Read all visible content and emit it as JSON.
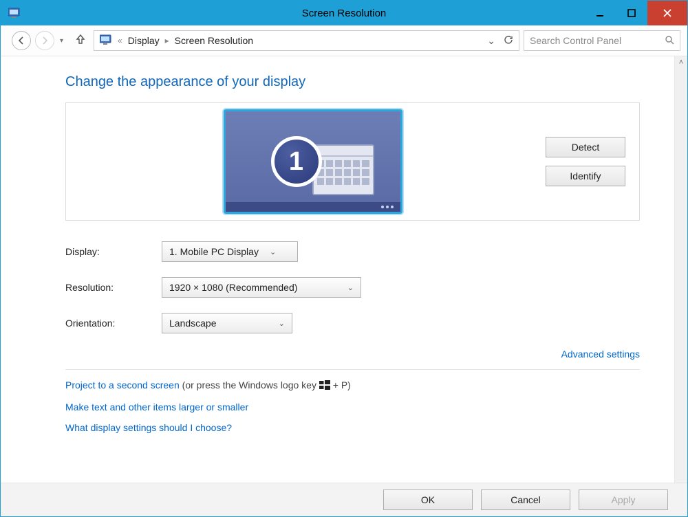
{
  "window": {
    "title": "Screen Resolution"
  },
  "breadcrumb": {
    "root_glyph": "«",
    "items": [
      "Display",
      "Screen Resolution"
    ]
  },
  "search": {
    "placeholder": "Search Control Panel"
  },
  "heading": "Change the appearance of your display",
  "preview": {
    "monitor_number": "1",
    "detect_label": "Detect",
    "identify_label": "Identify"
  },
  "form": {
    "display_label": "Display:",
    "display_value": "1. Mobile PC Display",
    "resolution_label": "Resolution:",
    "resolution_value": "1920 × 1080 (Recommended)",
    "orientation_label": "Orientation:",
    "orientation_value": "Landscape"
  },
  "advanced_link": "Advanced settings",
  "links": {
    "project_link": "Project to a second screen",
    "project_suffix_before": " (or press the Windows logo key ",
    "project_suffix_after": " + P)",
    "resize_link": "Make text and other items larger or smaller",
    "help_link": "What display settings should I choose?"
  },
  "footer": {
    "ok": "OK",
    "cancel": "Cancel",
    "apply": "Apply"
  }
}
